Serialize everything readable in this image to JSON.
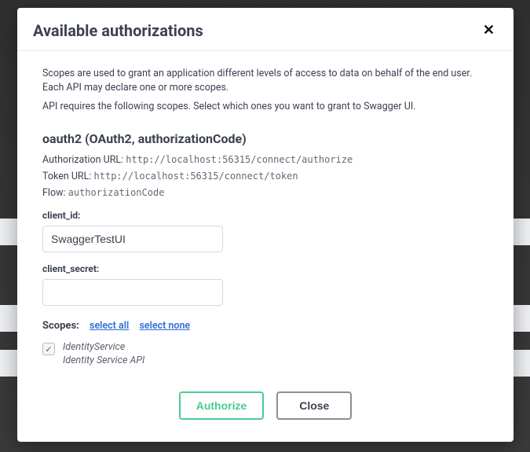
{
  "modal": {
    "title": "Available authorizations",
    "intro1": "Scopes are used to grant an application different levels of access to data on behalf of the end user. Each API may declare one or more scopes.",
    "intro2": "API requires the following scopes. Select which ones you want to grant to Swagger UI."
  },
  "auth": {
    "heading": "oauth2 (OAuth2, authorizationCode)",
    "authUrlLabel": "Authorization URL:",
    "authUrl": "http://localhost:56315/connect/authorize",
    "tokenUrlLabel": "Token URL:",
    "tokenUrl": "http://localhost:56315/connect/token",
    "flowLabel": "Flow:",
    "flow": "authorizationCode",
    "clientIdLabel": "client_id:",
    "clientIdValue": "SwaggerTestUI",
    "clientSecretLabel": "client_secret:",
    "clientSecretValue": ""
  },
  "scopes": {
    "label": "Scopes:",
    "selectAll": "select all",
    "selectNone": "select none",
    "items": [
      {
        "name": "IdentityService",
        "desc": "Identity Service API",
        "checked": true
      }
    ]
  },
  "buttons": {
    "authorize": "Authorize",
    "close": "Close"
  }
}
